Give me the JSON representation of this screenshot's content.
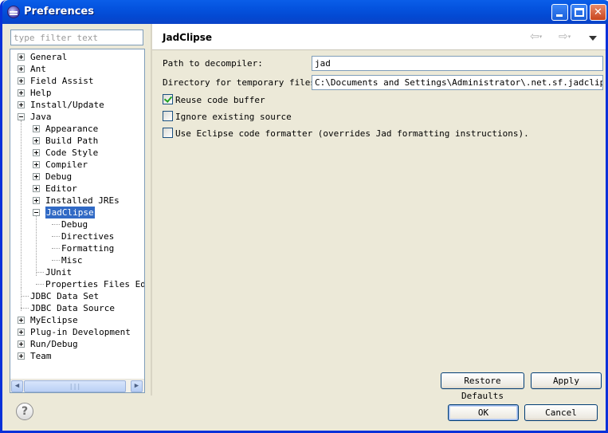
{
  "window": {
    "title": "Preferences"
  },
  "filter": {
    "placeholder": "type filter text"
  },
  "tree": [
    {
      "label": "General",
      "depth": 0,
      "state": "collapsed"
    },
    {
      "label": "Ant",
      "depth": 0,
      "state": "collapsed"
    },
    {
      "label": "Field Assist",
      "depth": 0,
      "state": "collapsed"
    },
    {
      "label": "Help",
      "depth": 0,
      "state": "collapsed"
    },
    {
      "label": "Install/Update",
      "depth": 0,
      "state": "collapsed"
    },
    {
      "label": "Java",
      "depth": 0,
      "state": "expanded"
    },
    {
      "label": "Appearance",
      "depth": 1,
      "state": "collapsed"
    },
    {
      "label": "Build Path",
      "depth": 1,
      "state": "collapsed"
    },
    {
      "label": "Code Style",
      "depth": 1,
      "state": "collapsed"
    },
    {
      "label": "Compiler",
      "depth": 1,
      "state": "collapsed"
    },
    {
      "label": "Debug",
      "depth": 1,
      "state": "collapsed"
    },
    {
      "label": "Editor",
      "depth": 1,
      "state": "collapsed"
    },
    {
      "label": "Installed JREs",
      "depth": 1,
      "state": "collapsed"
    },
    {
      "label": "JadClipse",
      "depth": 1,
      "state": "expanded",
      "selected": true
    },
    {
      "label": "Debug",
      "depth": 2,
      "state": "leaf"
    },
    {
      "label": "Directives",
      "depth": 2,
      "state": "leaf"
    },
    {
      "label": "Formatting",
      "depth": 2,
      "state": "leaf"
    },
    {
      "label": "Misc",
      "depth": 2,
      "state": "leaf"
    },
    {
      "label": "JUnit",
      "depth": 1,
      "state": "leaf"
    },
    {
      "label": "Properties Files Edit",
      "depth": 1,
      "state": "leaf"
    },
    {
      "label": "JDBC Data Set",
      "depth": 0,
      "state": "leaf"
    },
    {
      "label": "JDBC Data Source",
      "depth": 0,
      "state": "leaf"
    },
    {
      "label": "MyEclipse",
      "depth": 0,
      "state": "collapsed"
    },
    {
      "label": "Plug-in Development",
      "depth": 0,
      "state": "collapsed"
    },
    {
      "label": "Run/Debug",
      "depth": 0,
      "state": "collapsed"
    },
    {
      "label": "Team",
      "depth": 0,
      "state": "collapsed"
    }
  ],
  "page": {
    "title": "JadClipse",
    "fields": [
      {
        "label": "Path to decompiler:",
        "value": "jad"
      },
      {
        "label": "Directory for temporary files:",
        "value": "C:\\Documents and Settings\\Administrator\\.net.sf.jadclipse"
      }
    ],
    "checkboxes": [
      {
        "label": "Reuse code buffer",
        "checked": true
      },
      {
        "label": "Ignore existing source",
        "checked": false
      },
      {
        "label": "Use Eclipse code formatter (overrides Jad formatting instructions).",
        "checked": false
      }
    ],
    "restore_defaults": "Restore Defaults",
    "apply": "Apply"
  },
  "footer": {
    "help_icon": "?",
    "ok": "OK",
    "cancel": "Cancel"
  },
  "colors": {
    "title_bar": "#0554e0",
    "selection": "#316ac5",
    "dialog_bg": "#ece9d8"
  }
}
